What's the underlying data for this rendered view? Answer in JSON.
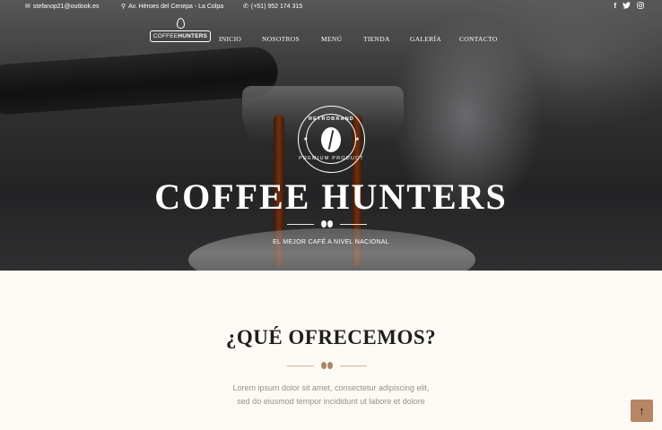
{
  "topbar": {
    "email": "stefanop21@outlook.es",
    "address": "Av. Héroes del Cenepa - La Colpa",
    "phone": "(+51) 952 174 315",
    "social": [
      "f",
      "🐦",
      "◎"
    ]
  },
  "logo": {
    "text_light": "COFFEE",
    "text_bold": "HUNTERS"
  },
  "nav": {
    "items": [
      "INICIO",
      "NOSOTROS",
      "MENÚ",
      "TIENDA",
      "GALERÍA",
      "CONTACTO"
    ]
  },
  "badge": {
    "top": "RETROBRAND",
    "bottom": "PREMIUM PRODUCT",
    "left_star": "★",
    "right_star": "★"
  },
  "hero": {
    "title": "COFFEE HUNTERS",
    "subtitle": "EL MEJOR CAFÉ A NIVEL NACIONAL"
  },
  "offer": {
    "title": "¿QUÉ OFRECEMOS?",
    "line1": "Lorem ipsum dolor sit amet, consectetur adipiscing elit,",
    "line2": "sed do eiusmod tempor incididunt ut labore et dolore"
  },
  "back_to_top": {
    "icon": "↑"
  },
  "colors": {
    "accent": "#b68665",
    "section_bg": "#fdfaf6",
    "divider_gold": "#d4b48a"
  }
}
